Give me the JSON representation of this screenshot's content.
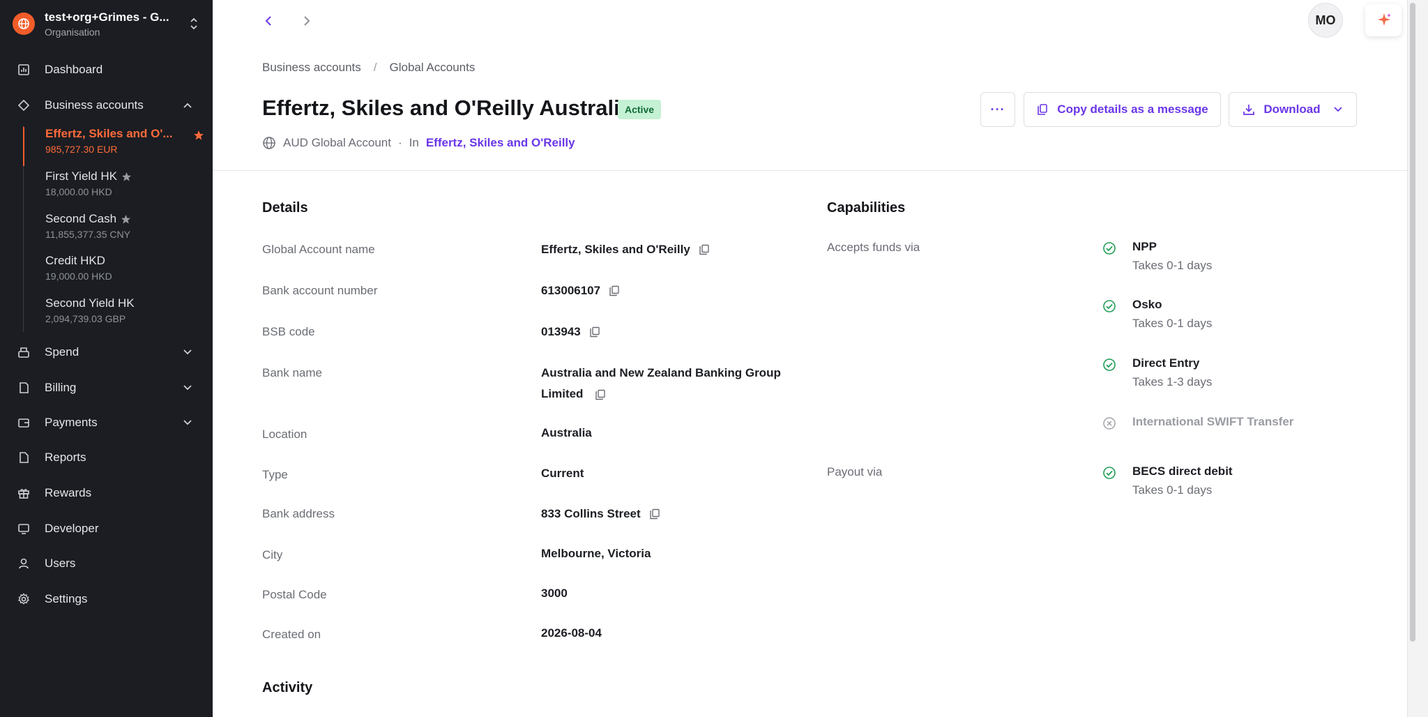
{
  "org": {
    "name": "test+org+Grimes - G...",
    "subtitle": "Organisation"
  },
  "nav": {
    "dashboard": "Dashboard",
    "business_accounts": "Business accounts",
    "spend": "Spend",
    "billing": "Billing",
    "payments": "Payments",
    "reports": "Reports",
    "rewards": "Rewards",
    "developer": "Developer",
    "users": "Users",
    "settings": "Settings"
  },
  "accounts": [
    {
      "name": "Effertz, Skiles and O'...",
      "balance": "985,727.30 EUR"
    },
    {
      "name": "First Yield HK",
      "balance": "18,000.00 HKD"
    },
    {
      "name": "Second Cash",
      "balance": "11,855,377.35 CNY"
    },
    {
      "name": "Credit HKD",
      "balance": "19,000.00 HKD"
    },
    {
      "name": "Second Yield HK",
      "balance": "2,094,739.03 GBP"
    }
  ],
  "header": {
    "avatar_initials": "MO"
  },
  "breadcrumb": {
    "parent": "Business accounts",
    "separator": "/",
    "current": "Global Accounts"
  },
  "page": {
    "title": "Effertz, Skiles and O'Reilly Australia",
    "status": "Active",
    "account_type": "AUD Global Account",
    "dot": "·",
    "in_label": "In",
    "parent_link": "Effertz, Skiles and O'Reilly"
  },
  "actions": {
    "more": "···",
    "copy_details": "Copy details as a message",
    "download": "Download"
  },
  "details": {
    "title": "Details",
    "rows": [
      {
        "label": "Global Account name",
        "value": "Effertz, Skiles and O'Reilly"
      },
      {
        "label": "Bank account number",
        "value": "613006107"
      },
      {
        "label": "BSB code",
        "value": "013943"
      },
      {
        "label": "Bank name",
        "value": "Australia and New Zealand Banking Group Limited"
      },
      {
        "label": "Location",
        "value": "Australia"
      },
      {
        "label": "Type",
        "value": "Current"
      },
      {
        "label": "Bank address",
        "value": "833 Collins Street"
      },
      {
        "label": "City",
        "value": "Melbourne, Victoria"
      },
      {
        "label": "Postal Code",
        "value": "3000"
      },
      {
        "label": "Created on",
        "value": "2026-08-04"
      }
    ]
  },
  "capabilities": {
    "title": "Capabilities",
    "accepts_label": "Accepts funds via",
    "payout_label": "Payout via",
    "accepts": [
      {
        "name": "NPP",
        "time": "Takes 0-1 days"
      },
      {
        "name": "Osko",
        "time": "Takes 0-1 days"
      },
      {
        "name": "Direct Entry",
        "time": "Takes 1-3 days"
      },
      {
        "name": "International SWIFT Transfer"
      }
    ],
    "payout": [
      {
        "name": "BECS direct debit",
        "time": "Takes 0-1 days"
      }
    ]
  },
  "activity": {
    "title": "Activity"
  },
  "colors": {
    "accent": "#6a36e8",
    "brand": "#f25c2a",
    "success": "#1f9d55",
    "sidebar_bg": "#1b1d22"
  }
}
